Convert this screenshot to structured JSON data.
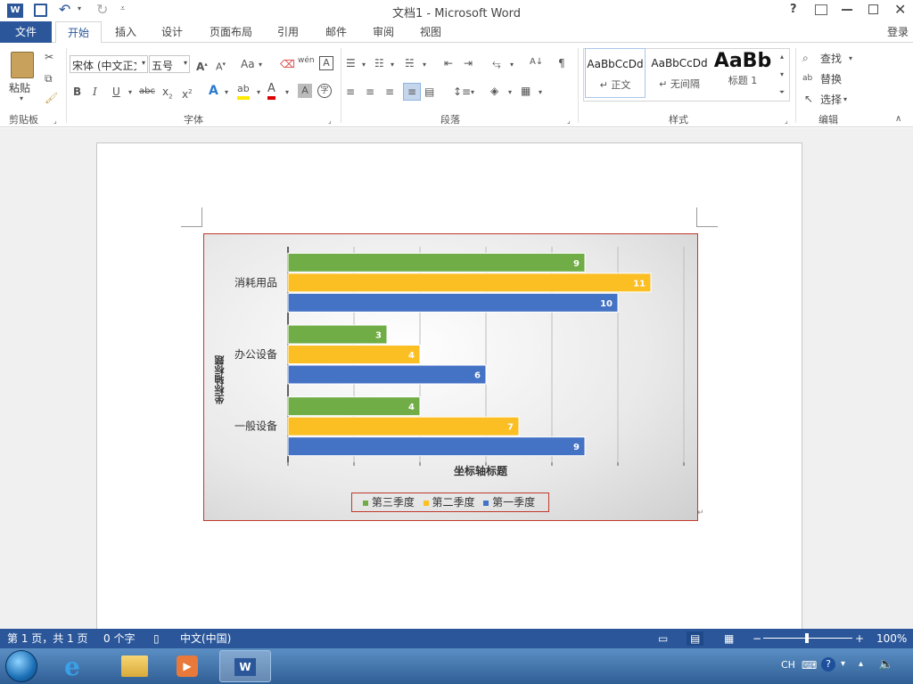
{
  "app": {
    "title": "文档1 - Microsoft Word",
    "login": "登录",
    "help": "?"
  },
  "tabs": [
    {
      "label": "文件"
    },
    {
      "label": "开始"
    },
    {
      "label": "插入"
    },
    {
      "label": "设计"
    },
    {
      "label": "页面布局"
    },
    {
      "label": "引用"
    },
    {
      "label": "邮件"
    },
    {
      "label": "审阅"
    },
    {
      "label": "视图"
    }
  ],
  "ribbon": {
    "clipboard": {
      "paste": "粘贴",
      "group": "剪贴板"
    },
    "font": {
      "name": "宋体 (中文正文",
      "size": "五号",
      "group": "字体",
      "wen": "wén",
      "aa": "Aa"
    },
    "paragraph": {
      "group": "段落"
    },
    "styles": {
      "group": "样式",
      "items": [
        {
          "preview": "AaBbCcDd",
          "name": "↵ 正文"
        },
        {
          "preview": "AaBbCcDd",
          "name": "↵ 无间隔"
        },
        {
          "preview": "AaBb",
          "name": "标题 1"
        }
      ]
    },
    "editing": {
      "find": "查找",
      "replace": "替换",
      "select": "选择",
      "group": "编辑"
    }
  },
  "status": {
    "page": "第 1 页，共 1 页",
    "words": "0 个字",
    "lang": "中文(中国)",
    "zoom": "100%",
    "zoom_level": 1.0
  },
  "taskbar": {
    "ime": "CH"
  },
  "chart_data": {
    "type": "bar",
    "orientation": "horizontal",
    "categories": [
      "一般设备",
      "办公设备",
      "消耗用品"
    ],
    "series": [
      {
        "name": "第一季度",
        "values": [
          9,
          6,
          10
        ],
        "color": "#4472c4"
      },
      {
        "name": "第二季度",
        "values": [
          7,
          4,
          11
        ],
        "color": "#fbbf24"
      },
      {
        "name": "第三季度",
        "values": [
          4,
          3,
          9
        ],
        "color": "#70ad47"
      }
    ],
    "xlabel": "坐标轴标题",
    "ylabel": "坐标轴标题",
    "xlim": [
      0,
      12
    ],
    "grid": true,
    "legend_position": "bottom"
  }
}
